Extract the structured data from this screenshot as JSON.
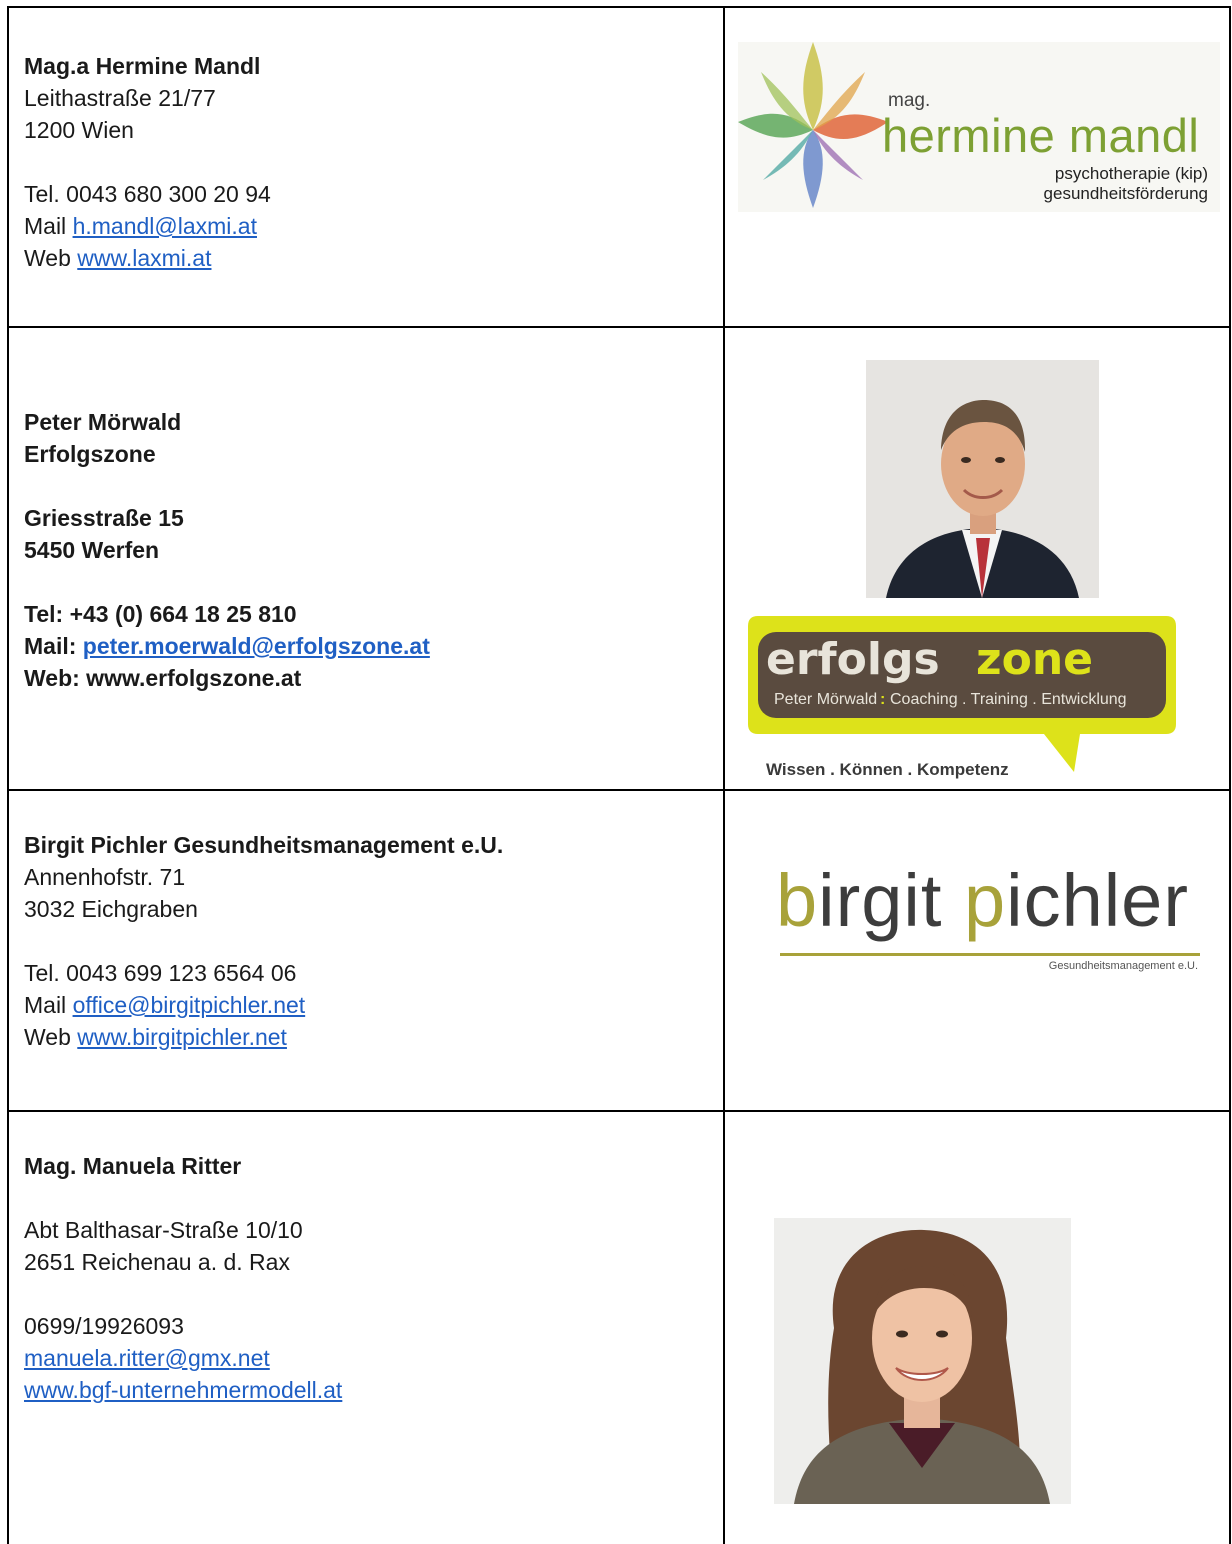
{
  "entries": [
    {
      "name": "Mag.a Hermine Mandl",
      "street": "Leithastraße 21/77",
      "city": "1200 Wien",
      "tel": "Tel. 0043 680 300 20 94",
      "mail_label": "Mail ",
      "mail": "h.mandl@laxmi.at",
      "web_label": "Web ",
      "web": "www.laxmi.at",
      "logo": {
        "small": "mag.",
        "name": "hermine mandl",
        "sub1": "psychotherapie (kip)",
        "sub2": "gesundheitsförderung"
      }
    },
    {
      "name": "Peter Mörwald",
      "company": "Erfolgszone",
      "street": "Griesstraße 15",
      "city": "5450 Werfen",
      "tel": "Tel: +43 (0) 664 18 25 810",
      "mail_label": "Mail: ",
      "mail": "peter.moerwald@erfolgszone.at",
      "web": "Web: www.erfolgszone.at",
      "logo": {
        "word1": "erfolgs",
        "word2": "zone",
        "sub_name": "Peter Mörwald",
        "sub_sep": ":",
        "sub_rest": "Coaching . Training . Entwicklung",
        "tagline": "Wissen . Können . Kompetenz"
      }
    },
    {
      "name": "Birgit Pichler Gesundheitsmanagement e.U.",
      "street": "Annenhofstr. 71",
      "city": "3032 Eichgraben",
      "tel": "Tel. 0043 699 123 6564 06",
      "mail_label": "Mail ",
      "mail": "office@birgitpichler.net",
      "web_label": "Web ",
      "web": "www.birgitpichler.net",
      "logo": {
        "b": "b",
        "irgit": "irgit ",
        "p": "p",
        "ichler": "ichler",
        "sub": "Gesundheitsmanagement e.U."
      }
    },
    {
      "name": "Mag. Manuela Ritter",
      "street": "Abt Balthasar-Straße 10/10",
      "city": "2651 Reichenau a. d. Rax",
      "tel": "0699/19926093",
      "mail": "manuela.ritter@gmx.net",
      "web": "www.bgf-unternehmermodell.at"
    }
  ]
}
